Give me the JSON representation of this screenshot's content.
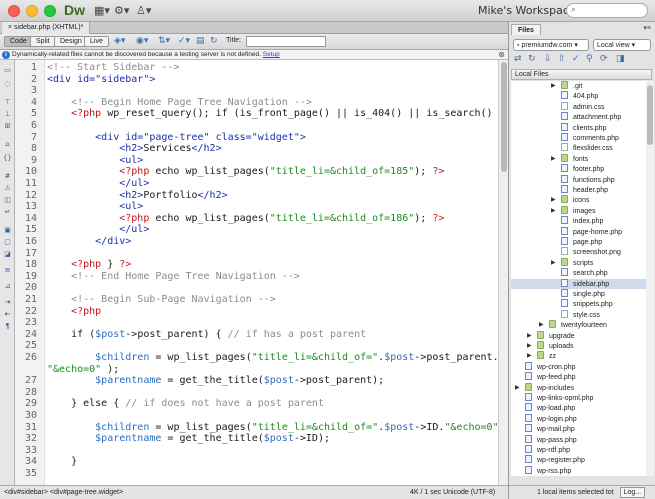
{
  "app": {
    "logo": "Dw",
    "workspace": "Mike's Workspace",
    "workspace_arrow": "▾",
    "search_icon": "⌕"
  },
  "document": {
    "tab_label": "sidebar.php (XHTML)*",
    "views": [
      "Code",
      "Split",
      "Design",
      "Live"
    ],
    "active_view": "Code",
    "title_label": "Title:",
    "title_value": ""
  },
  "infobar": {
    "message": "Dynamically-related files cannot be discovered because a testing server is not defined.",
    "link": "Setup"
  },
  "code_lines": [
    {
      "n": "1",
      "segs": [
        [
          "cm",
          "<!-- Start Sidebar -->"
        ]
      ]
    },
    {
      "n": "2",
      "segs": [
        [
          "tag",
          "<div id=\"sidebar\">"
        ]
      ]
    },
    {
      "n": "3",
      "segs": []
    },
    {
      "n": "4",
      "segs": [
        [
          "cm",
          "    <!-- Begin Home Page Tree Navigation -->"
        ]
      ]
    },
    {
      "n": "5",
      "segs": [
        [
          "php",
          "    <?php "
        ],
        [
          "fn",
          "wp_reset_query(); if (is_front_page() || is_404() || is_search() ) { "
        ],
        [
          "php",
          "?>"
        ]
      ]
    },
    {
      "n": "6",
      "segs": []
    },
    {
      "n": "7",
      "segs": [
        [
          "tag",
          "        <div id=\"page-tree\" class=\"widget\">"
        ]
      ]
    },
    {
      "n": "8",
      "segs": [
        [
          "tag",
          "            <h2>"
        ],
        [
          "fn",
          "Services"
        ],
        [
          "tag",
          "</h2>"
        ]
      ]
    },
    {
      "n": "9",
      "segs": [
        [
          "tag",
          "            <ul>"
        ]
      ]
    },
    {
      "n": "10",
      "segs": [
        [
          "php",
          "            <?php "
        ],
        [
          "fn",
          "echo wp_list_pages("
        ],
        [
          "str",
          "\"title_li=&child_of=185\""
        ],
        [
          "fn",
          "); "
        ],
        [
          "php",
          "?>"
        ]
      ]
    },
    {
      "n": "11",
      "segs": [
        [
          "tag",
          "            </ul>"
        ]
      ]
    },
    {
      "n": "12",
      "segs": [
        [
          "tag",
          "            <h2>"
        ],
        [
          "fn",
          "Portfolio"
        ],
        [
          "tag",
          "</h2>"
        ]
      ]
    },
    {
      "n": "13",
      "segs": [
        [
          "tag",
          "            <ul>"
        ]
      ]
    },
    {
      "n": "14",
      "segs": [
        [
          "php",
          "            <?php "
        ],
        [
          "fn",
          "echo wp_list_pages("
        ],
        [
          "str",
          "\"title_li=&child_of=186\""
        ],
        [
          "fn",
          "); "
        ],
        [
          "php",
          "?>"
        ]
      ]
    },
    {
      "n": "15",
      "segs": [
        [
          "tag",
          "            </ul>"
        ]
      ]
    },
    {
      "n": "16",
      "segs": [
        [
          "tag",
          "        </div>"
        ]
      ]
    },
    {
      "n": "17",
      "segs": []
    },
    {
      "n": "18",
      "segs": [
        [
          "php",
          "    <?php "
        ],
        [
          "fn",
          "} "
        ],
        [
          "php",
          "?>"
        ]
      ]
    },
    {
      "n": "19",
      "segs": [
        [
          "cm",
          "    <!-- End Home Page Tree Navigation -->"
        ]
      ]
    },
    {
      "n": "20",
      "segs": []
    },
    {
      "n": "21",
      "segs": [
        [
          "cm",
          "    <!-- Begin Sub-Page Navigation -->"
        ]
      ]
    },
    {
      "n": "22",
      "segs": [
        [
          "php",
          "    <?php"
        ]
      ]
    },
    {
      "n": "23",
      "segs": []
    },
    {
      "n": "24",
      "segs": [
        [
          "fn",
          "    if ("
        ],
        [
          "var",
          "$post"
        ],
        [
          "fn",
          "->post_parent) { "
        ],
        [
          "cm",
          "// if has a post parent"
        ]
      ]
    },
    {
      "n": "25",
      "segs": []
    },
    {
      "n": "26",
      "segs": [
        [
          "var",
          "        $children"
        ],
        [
          "fn",
          " = wp_list_pages("
        ],
        [
          "str",
          "\"title_li=&child_of=\""
        ],
        [
          "fn",
          "."
        ],
        [
          "var",
          "$post"
        ],
        [
          "fn",
          "->post_parent."
        ]
      ]
    },
    {
      "n": "",
      "segs": [
        [
          "str",
          "\"&echo=0\""
        ],
        [
          "fn",
          " );"
        ]
      ]
    },
    {
      "n": "27",
      "segs": [
        [
          "var",
          "        $parentname"
        ],
        [
          "fn",
          " = get_the_title("
        ],
        [
          "var",
          "$post"
        ],
        [
          "fn",
          "->post_parent);"
        ]
      ]
    },
    {
      "n": "28",
      "segs": []
    },
    {
      "n": "29",
      "segs": [
        [
          "fn",
          "    } else { "
        ],
        [
          "cm",
          "// if does not have a post parent"
        ]
      ]
    },
    {
      "n": "30",
      "segs": []
    },
    {
      "n": "31",
      "segs": [
        [
          "var",
          "        $children"
        ],
        [
          "fn",
          " = wp_list_pages("
        ],
        [
          "str",
          "\"title_li=&child_of=\""
        ],
        [
          "fn",
          "."
        ],
        [
          "var",
          "$post"
        ],
        [
          "fn",
          "->ID."
        ],
        [
          "str",
          "\"&echo=0\""
        ],
        [
          "fn",
          " );"
        ]
      ]
    },
    {
      "n": "32",
      "segs": [
        [
          "var",
          "        $parentname"
        ],
        [
          "fn",
          " = get_the_title("
        ],
        [
          "var",
          "$post"
        ],
        [
          "fn",
          "->ID);"
        ]
      ]
    },
    {
      "n": "33",
      "segs": []
    },
    {
      "n": "34",
      "segs": [
        [
          "fn",
          "    }"
        ]
      ]
    },
    {
      "n": "35",
      "segs": []
    }
  ],
  "statusbar": {
    "tags": "<div#sidebar> <div#page-tree.widget>",
    "info": "4K / 1 sec  Unicode (UTF-8)"
  },
  "files_panel": {
    "tab": "Files",
    "site": "premiumdw.com",
    "view": "Local view",
    "header": "Local Files",
    "items": [
      {
        "name": ".git",
        "type": "folder",
        "indent": 3,
        "arrow": true
      },
      {
        "name": "404.php",
        "type": "php",
        "indent": 3
      },
      {
        "name": "admin.css",
        "type": "file",
        "indent": 3
      },
      {
        "name": "attachment.php",
        "type": "php",
        "indent": 3
      },
      {
        "name": "clients.php",
        "type": "php",
        "indent": 3
      },
      {
        "name": "comments.php",
        "type": "php",
        "indent": 3
      },
      {
        "name": "flexslider.css",
        "type": "file",
        "indent": 3
      },
      {
        "name": "fonts",
        "type": "folder",
        "indent": 3,
        "arrow": true
      },
      {
        "name": "footer.php",
        "type": "php",
        "indent": 3
      },
      {
        "name": "functions.php",
        "type": "php",
        "indent": 3
      },
      {
        "name": "header.php",
        "type": "php",
        "indent": 3
      },
      {
        "name": "icons",
        "type": "folder",
        "indent": 3,
        "arrow": true
      },
      {
        "name": "images",
        "type": "folder",
        "indent": 3,
        "arrow": true
      },
      {
        "name": "index.php",
        "type": "php",
        "indent": 3
      },
      {
        "name": "page-home.php",
        "type": "php",
        "indent": 3
      },
      {
        "name": "page.php",
        "type": "php",
        "indent": 3
      },
      {
        "name": "screenshot.png",
        "type": "file",
        "indent": 3
      },
      {
        "name": "scripts",
        "type": "folder",
        "indent": 3,
        "arrow": true
      },
      {
        "name": "search.php",
        "type": "php",
        "indent": 3
      },
      {
        "name": "sidebar.php",
        "type": "php",
        "indent": 3,
        "selected": true
      },
      {
        "name": "single.php",
        "type": "php",
        "indent": 3
      },
      {
        "name": "snippets.php",
        "type": "php",
        "indent": 3
      },
      {
        "name": "style.css",
        "type": "file",
        "indent": 3
      },
      {
        "name": "twentyfourteen",
        "type": "folder",
        "indent": 2,
        "arrow": true
      },
      {
        "name": "upgrade",
        "type": "folder",
        "indent": 1,
        "arrow": true
      },
      {
        "name": "uploads",
        "type": "folder",
        "indent": 1,
        "arrow": true
      },
      {
        "name": "zz",
        "type": "folder",
        "indent": 1,
        "arrow": true
      },
      {
        "name": "wp-cron.php",
        "type": "php",
        "indent": 0
      },
      {
        "name": "wp-feed.php",
        "type": "php",
        "indent": 0
      },
      {
        "name": "wp-includes",
        "type": "folder",
        "indent": 0,
        "arrow": true
      },
      {
        "name": "wp-links-opml.php",
        "type": "php",
        "indent": 0
      },
      {
        "name": "wp-load.php",
        "type": "php",
        "indent": 0
      },
      {
        "name": "wp-login.php",
        "type": "php",
        "indent": 0
      },
      {
        "name": "wp-mail.php",
        "type": "php",
        "indent": 0
      },
      {
        "name": "wp-pass.php",
        "type": "php",
        "indent": 0
      },
      {
        "name": "wp-rdf.php",
        "type": "php",
        "indent": 0
      },
      {
        "name": "wp-register.php",
        "type": "php",
        "indent": 0
      },
      {
        "name": "wp-rss.php",
        "type": "php",
        "indent": 0
      }
    ],
    "status": "1 local items selected tot",
    "log_button": "Log..."
  }
}
